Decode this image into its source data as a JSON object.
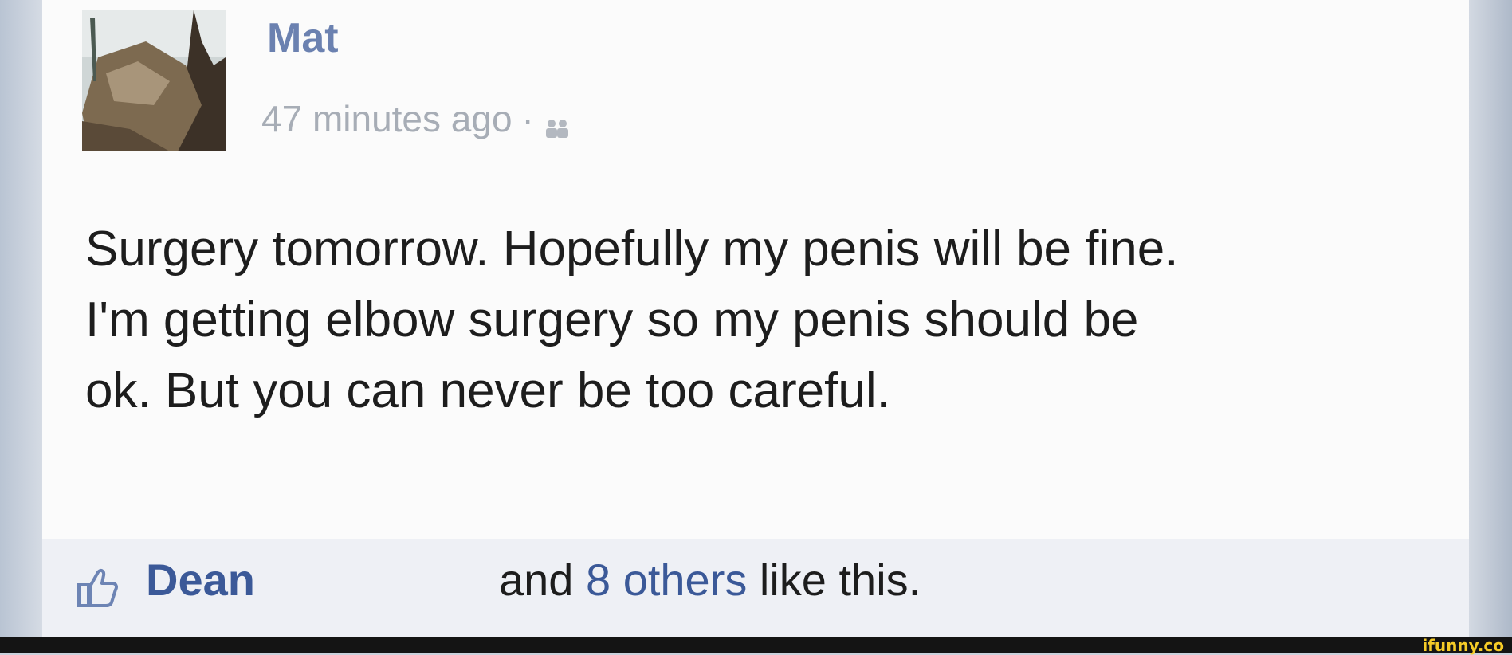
{
  "post": {
    "author": "Mat",
    "timestamp": "47 minutes ago",
    "separator": "·",
    "audience_icon": "friends-icon",
    "text": "Surgery tomorrow. Hopefully my penis will be fine.\nI'm getting elbow surgery so my penis should be\nok. But you can never be too careful."
  },
  "likes": {
    "icon": "thumbs-up-icon",
    "first_name": "Dean",
    "middle": "and",
    "others": "8 others",
    "suffix": "like this."
  },
  "watermark": "ifunny.co",
  "colors": {
    "link": "#3b5998",
    "muted": "#a7adb6",
    "text": "#1d1d1d",
    "likes_bar": "#eef0f5",
    "watermark": "#f6cc27"
  }
}
